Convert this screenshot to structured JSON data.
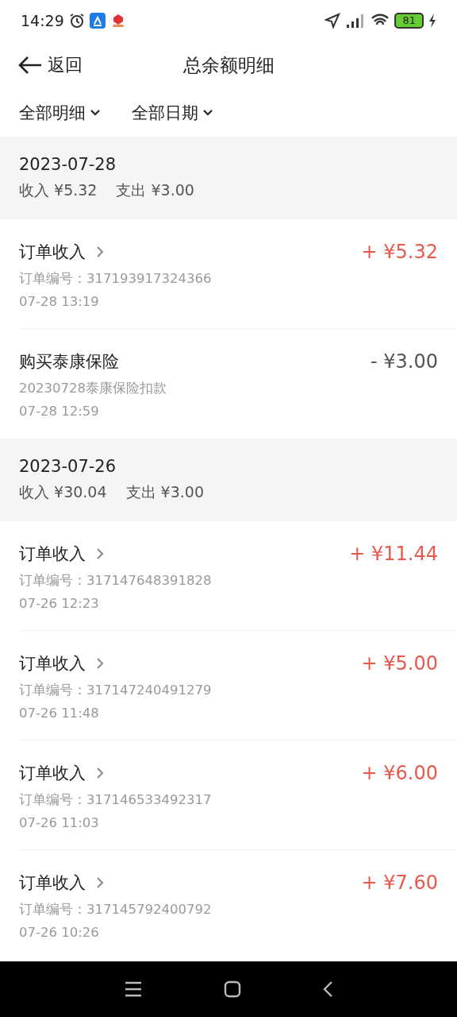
{
  "status_bar": {
    "time": "14:29",
    "battery": "81"
  },
  "header": {
    "back_label": "返回",
    "title": "总余额明细"
  },
  "filters": [
    {
      "label": "全部明细"
    },
    {
      "label": "全部日期"
    }
  ],
  "groups": [
    {
      "date": "2023-07-28",
      "income": "收入 ¥5.32",
      "expense": "支出 ¥3.00",
      "items": [
        {
          "kind": "order",
          "title": "订单收入",
          "detail": "订单编号：317193917324366",
          "time": "07-28 13:19",
          "amount": "+ ¥5.32"
        },
        {
          "kind": "purchase",
          "title": "购买泰康保险",
          "detail": "20230728泰康保险扣款",
          "time": "07-28 12:59",
          "amount": "- ¥3.00"
        }
      ]
    },
    {
      "date": "2023-07-26",
      "income": "收入 ¥30.04",
      "expense": "支出 ¥3.00",
      "items": [
        {
          "kind": "order",
          "title": "订单收入",
          "detail": "订单编号：317147648391828",
          "time": "07-26 12:23",
          "amount": "+ ¥11.44"
        },
        {
          "kind": "order",
          "title": "订单收入",
          "detail": "订单编号：317147240491279",
          "time": "07-26 11:48",
          "amount": "+ ¥5.00"
        },
        {
          "kind": "order",
          "title": "订单收入",
          "detail": "订单编号：317146533492317",
          "time": "07-26 11:03",
          "amount": "+ ¥6.00"
        },
        {
          "kind": "order",
          "title": "订单收入",
          "detail": "订单编号：317145792400792",
          "time": "07-26 10:26",
          "amount": "+ ¥7.60"
        }
      ]
    }
  ]
}
